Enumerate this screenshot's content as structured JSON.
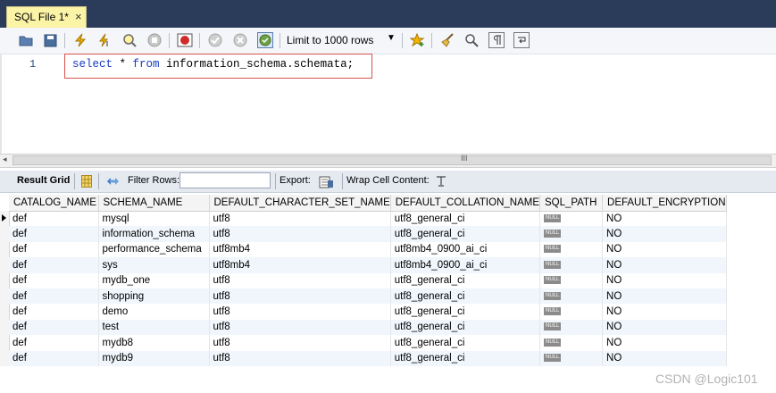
{
  "tab": {
    "label": "SQL File 1*",
    "close": "×"
  },
  "toolbar": {
    "limit_label": "Limit to 1000 rows",
    "icons": [
      "open-folder-icon",
      "save-icon",
      "execute-lightning-icon",
      "execute-cursor-icon",
      "explain-magnifier-icon",
      "stop-icon",
      "toggle-error-icon",
      "commit-icon",
      "rollback-icon",
      "autocommit-icon",
      "bookmark-star-icon",
      "beautify-broom-icon",
      "find-icon",
      "invisible-chars-icon",
      "wrap-icon"
    ]
  },
  "editor": {
    "line_number": "1",
    "code": {
      "kw1": "select",
      "mid1": " * ",
      "kw2": "from",
      "rest": " information_schema.schemata;"
    }
  },
  "scrollbar": {
    "left_arrow": "◂",
    "grip": "III"
  },
  "result_bar": {
    "grid_label": "Result Grid",
    "filter_label": "Filter Rows:",
    "export_label": "Export:",
    "wrap_label": "Wrap Cell Content:"
  },
  "grid": {
    "columns": [
      "CATALOG_NAME",
      "SCHEMA_NAME",
      "DEFAULT_CHARACTER_SET_NAME",
      "DEFAULT_COLLATION_NAME",
      "SQL_PATH",
      "DEFAULT_ENCRYPTION"
    ],
    "null_text": "NULL",
    "rows": [
      [
        "def",
        "mysql",
        "utf8",
        "utf8_general_ci",
        "NULL",
        "NO"
      ],
      [
        "def",
        "information_schema",
        "utf8",
        "utf8_general_ci",
        "NULL",
        "NO"
      ],
      [
        "def",
        "performance_schema",
        "utf8mb4",
        "utf8mb4_0900_ai_ci",
        "NULL",
        "NO"
      ],
      [
        "def",
        "sys",
        "utf8mb4",
        "utf8mb4_0900_ai_ci",
        "NULL",
        "NO"
      ],
      [
        "def",
        "mydb_one",
        "utf8",
        "utf8_general_ci",
        "NULL",
        "NO"
      ],
      [
        "def",
        "shopping",
        "utf8",
        "utf8_general_ci",
        "NULL",
        "NO"
      ],
      [
        "def",
        "demo",
        "utf8",
        "utf8_general_ci",
        "NULL",
        "NO"
      ],
      [
        "def",
        "test",
        "utf8",
        "utf8_general_ci",
        "NULL",
        "NO"
      ],
      [
        "def",
        "mydb8",
        "utf8",
        "utf8_general_ci",
        "NULL",
        "NO"
      ],
      [
        "def",
        "mydb9",
        "utf8",
        "utf8_general_ci",
        "NULL",
        "NO"
      ]
    ]
  },
  "watermark": "CSDN @Logic101"
}
